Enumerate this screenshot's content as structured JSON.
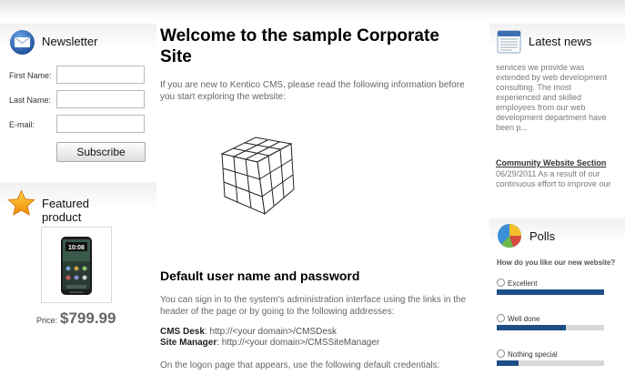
{
  "newsletter": {
    "title": "Newsletter",
    "first_name_label": "First Name:",
    "last_name_label": "Last Name:",
    "email_label": "E-mail:",
    "first_name_value": "",
    "last_name_value": "",
    "email_value": "",
    "subscribe_label": "Subscribe"
  },
  "featured": {
    "title": "Featured product",
    "price_label": "Price:",
    "price": "$799.99",
    "phone_clock": "10:08"
  },
  "main": {
    "welcome_title": "Welcome to the sample Corporate Site",
    "intro": "If you are new to Kentico CMS, please read the following information before you start exploring the website:",
    "default_heading": "Default user name and password",
    "signin_text": "You can sign in to the system's administration interface using the links in the header of the page or by going to the following addresses:",
    "cms_desk_label": "CMS Desk",
    "cms_desk_url": ": http://<your domain>/CMSDesk",
    "site_manager_label": "Site Manager",
    "site_manager_url": ": http://<your domain>/CMSSiteManager",
    "logon_text": "On the logon page that appears, use the following default credentials:"
  },
  "news": {
    "title": "Latest news",
    "item1_text": "services we provide was extended by web development consulting. The most experienced and skilled employees from our web development department have been p...",
    "item2_title": "Community Website Section",
    "item2_text": "06/29/2011 As a result of our continuous effort to improve our"
  },
  "polls": {
    "title": "Polls",
    "question": "How do you like our new website?",
    "options": [
      {
        "label": "Excellent",
        "fraction": 1.0
      },
      {
        "label": "Well done",
        "fraction": 0.64
      },
      {
        "label": "Nothing special",
        "fraction": 0.2
      }
    ]
  },
  "colors": {
    "poll_bar": "#1d4f87",
    "poll_track": "#d8d8d8",
    "news_link": "#333333"
  }
}
